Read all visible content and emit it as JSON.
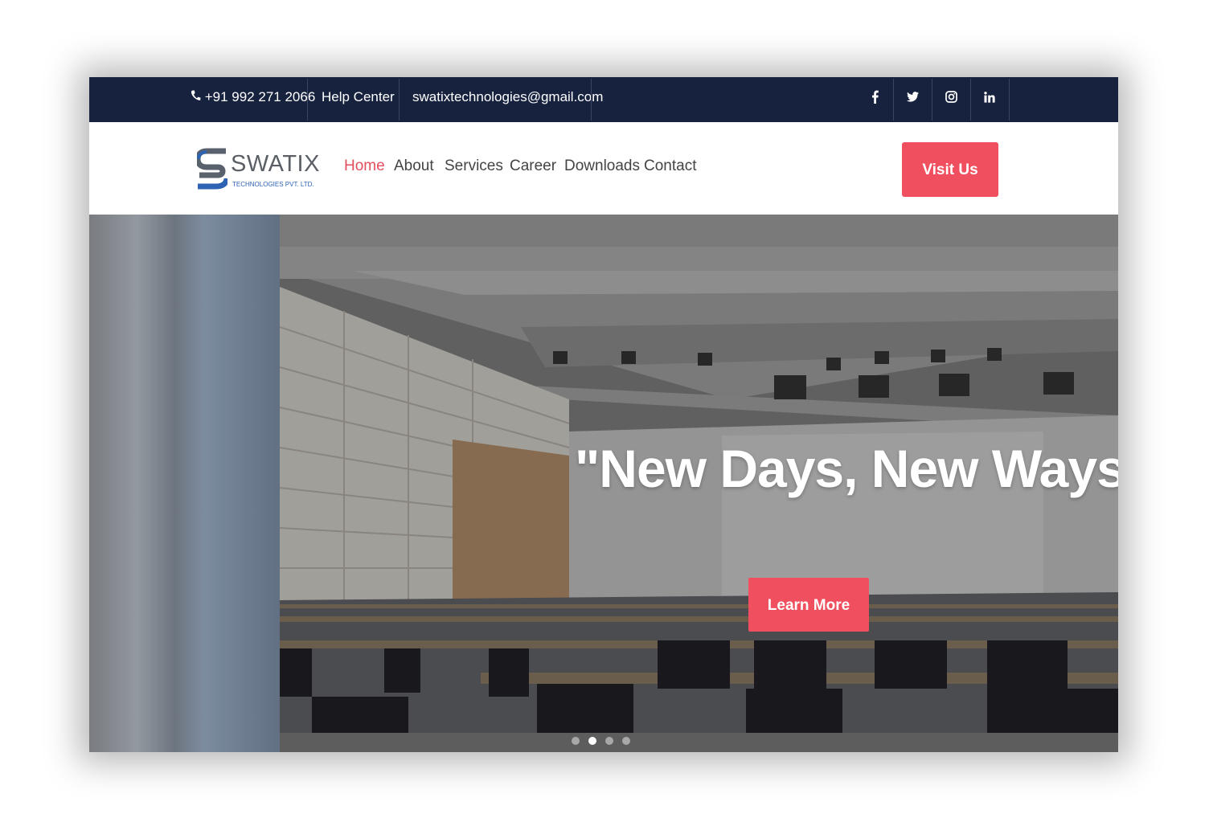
{
  "topbar": {
    "phone": "+91 992 271 2066",
    "help": "Help Center",
    "email": "swatixtechnologies@gmail.com",
    "social": [
      "facebook-icon",
      "twitter-icon",
      "instagram-icon",
      "linkedin-icon"
    ]
  },
  "brand": {
    "name": "SWATIX",
    "tagline": "TECHNOLOGIES PVT. LTD."
  },
  "nav": {
    "items": [
      "Home",
      "About",
      "Services",
      "Career",
      "Downloads",
      "Contact"
    ],
    "active": "Home",
    "cta": "Visit Us"
  },
  "hero": {
    "title": "\"New Days, New Ways\"",
    "button": "Learn More",
    "slides": 4,
    "active_slide": 2
  },
  "colors": {
    "topbar": "#17223f",
    "accent": "#ef4f5e",
    "brand_blue": "#2e63b4"
  }
}
